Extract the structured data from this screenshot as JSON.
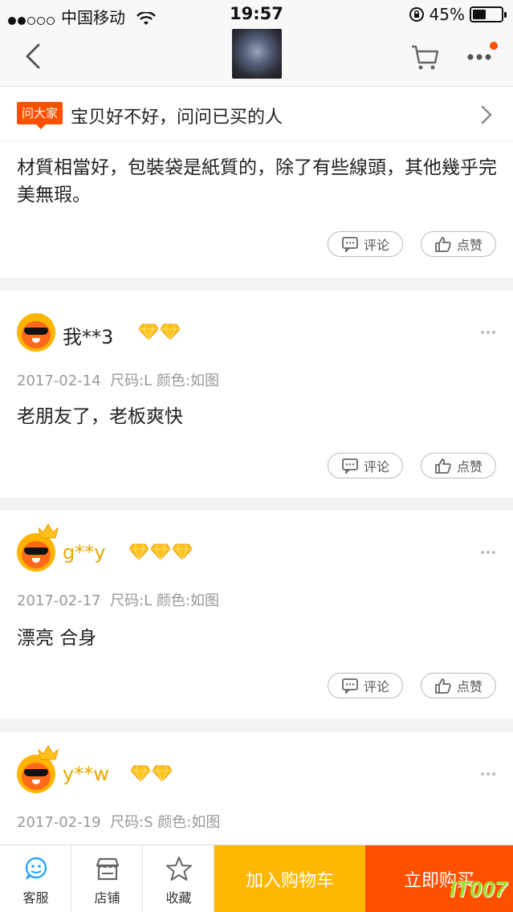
{
  "status_bar": {
    "carrier": "中国移动",
    "time": "19:57",
    "battery": "45%",
    "battery_level": 0.45
  },
  "nav": {
    "back_icon": "chevron-left-icon",
    "cart_icon": "cart-icon",
    "more_icon": "more-icon",
    "accent": "#ff5000"
  },
  "ask": {
    "tag": "问大家",
    "text": "宝贝好不好，问问已买的人"
  },
  "top_review": {
    "text": "材質相當好，包裝袋是紙質的，除了有些線頭，其他幾乎完美無瑕。",
    "comment_label": "评论",
    "like_label": "点赞"
  },
  "reviews": [
    {
      "user": "我**3",
      "gem_count": 2,
      "date": "2017-02-14",
      "spec": "尺码:L 颜色:如图",
      "text": "老朋友了，老板爽快",
      "comment_label": "评论",
      "like_label": "点赞"
    },
    {
      "user": "g**y",
      "gem_count": 3,
      "date": "2017-02-17",
      "spec": "尺码:L 颜色:如图",
      "text": "漂亮 合身",
      "comment_label": "评论",
      "like_label": "点赞"
    },
    {
      "user": "y**w",
      "gem_count": 2,
      "date": "2017-02-19",
      "spec": "尺码:S 颜色:如图"
    }
  ],
  "bottom_bar": {
    "service": "客服",
    "shop": "店铺",
    "favorite": "收藏",
    "add_to_cart": "加入购物车",
    "buy_now": "立即购买",
    "cart_color": "#ffb800",
    "buy_color": "#ff5000"
  },
  "watermark": "IT007"
}
